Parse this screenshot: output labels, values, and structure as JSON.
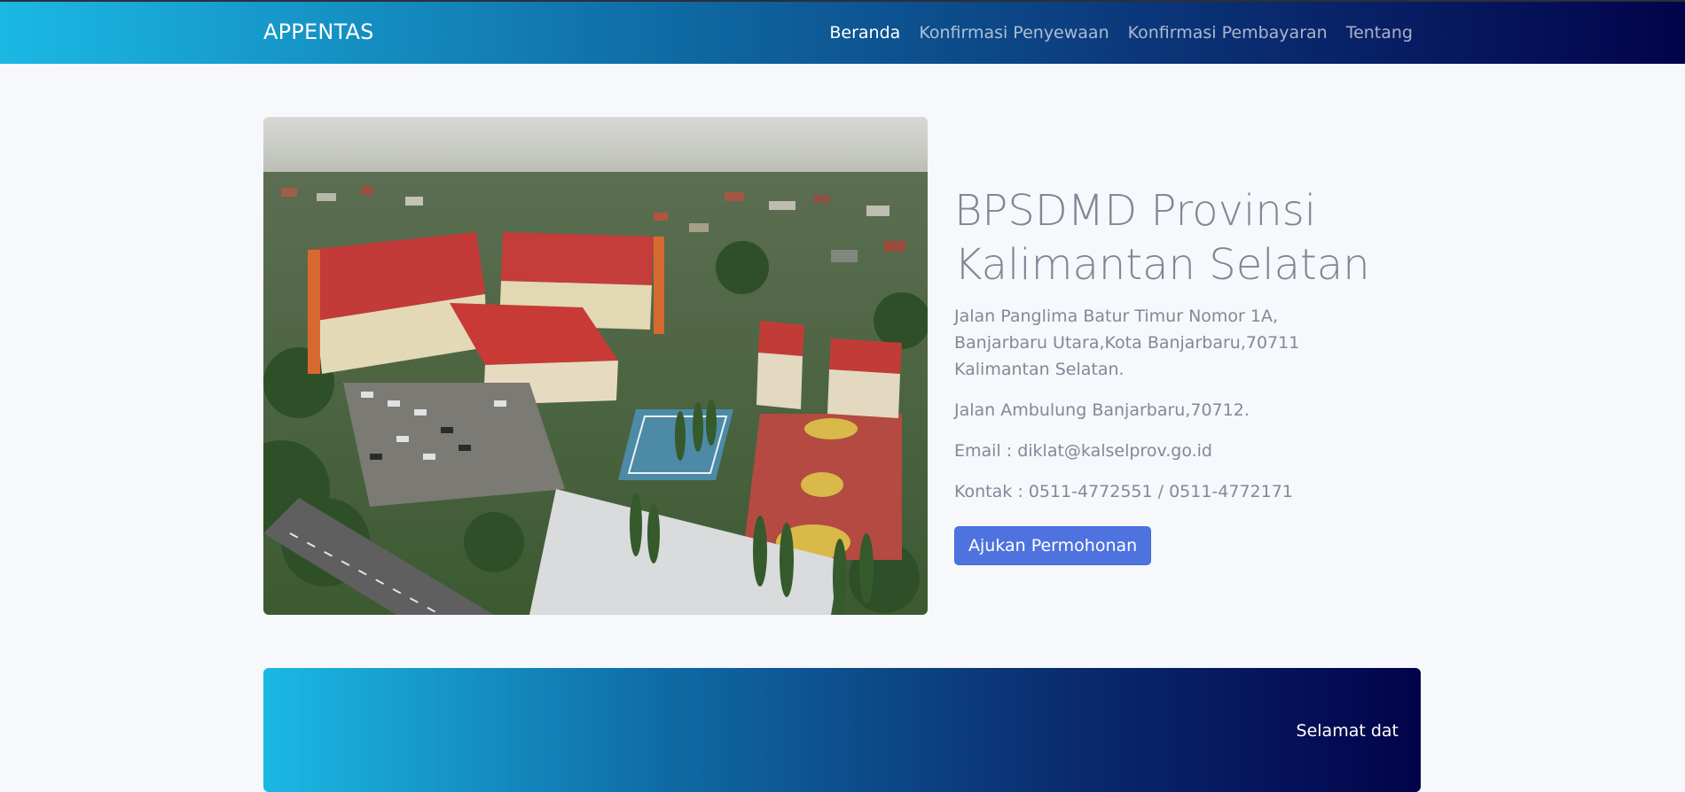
{
  "navbar": {
    "brand": "APPENTAS",
    "items": [
      {
        "label": "Beranda",
        "active": true
      },
      {
        "label": "Konfirmasi Penyewaan",
        "active": false
      },
      {
        "label": "Konfirmasi Pembayaran",
        "active": false
      },
      {
        "label": "Tentang",
        "active": false
      }
    ]
  },
  "hero": {
    "title_line1": "BPSDMD Provinsi",
    "title_line2": "Kalimantan Selatan",
    "address1": "Jalan Panglima Batur Timur Nomor 1A, Banjarbaru Utara,Kota Banjarbaru,70711 Kalimantan Selatan.",
    "address2": "Jalan Ambulung Banjarbaru,70712.",
    "email": "Email : diklat@kalselprov.go.id",
    "contact": "Kontak : 0511-4772551 / 0511-4772171",
    "button_label": "Ajukan Permohonan"
  },
  "banner": {
    "text": "Selamat dat"
  }
}
